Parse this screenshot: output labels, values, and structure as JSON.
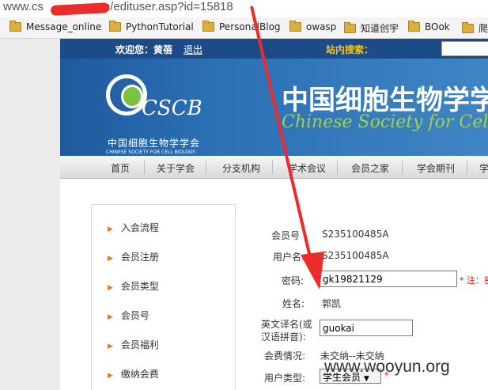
{
  "browser": {
    "url_visible": "www.cs",
    "url_path": "n/edituser.asp?id=15818",
    "bookmarks": [
      {
        "label": "Message_online",
        "icon": "folder-icon"
      },
      {
        "label": "PythonTutorial",
        "icon": "folder-icon"
      },
      {
        "label": "PersonalBlog",
        "icon": "folder-icon"
      },
      {
        "label": "owasp",
        "icon": "folder-icon"
      },
      {
        "label": "知道创宇",
        "icon": "folder-icon"
      },
      {
        "label": "BOok",
        "icon": "folder-icon"
      },
      {
        "label": "爬",
        "icon": "folder-icon"
      }
    ]
  },
  "topbar": {
    "welcome": "欢迎您：黄蓓",
    "logout": "退出",
    "site_search": "站内搜索："
  },
  "banner": {
    "logo_text": "CSCB",
    "logo_cn": "中国细胞生物学学会",
    "logo_en": "CHINESE SOCIETY FOR CELL BIOLOGY",
    "title_cn": "中国细胞生物学学",
    "title_en": "Chinese Society for Cell B"
  },
  "nav": {
    "items": [
      "首页",
      "关于学会",
      "分支机构",
      "学术会议",
      "会员之家",
      "学会期刊",
      "学"
    ]
  },
  "sidebar": {
    "items": [
      "入会流程",
      "会员注册",
      "会员类型",
      "会员号",
      "会员福利",
      "缴纳会费"
    ]
  },
  "form": {
    "member_no_label": "会员号",
    "member_no": "S235100485A",
    "username_label": "用户名:",
    "username": "S235100485A",
    "password_label": "密码:",
    "password_value": "gk19821129",
    "password_note": "* 注：密",
    "name_label": "姓名:",
    "name": "郭凯",
    "en_name_label_1": "英文译名(或",
    "en_name_label_2": "汉语拼音):",
    "en_name_value": "guokai",
    "fee_label": "会费情况:",
    "fee_value": "未交纳--未交纳",
    "user_type_label": "用户类型:",
    "user_type_value": "学生会员",
    "user_type_required": "*"
  },
  "watermark": "www.wooyun.org",
  "colors": {
    "topbar": "#1d4b87",
    "banner": "#2b6fb5",
    "title_en": "#9fd247",
    "annotation_arrow": "#ee2b2b",
    "logo_green": "#7ec142"
  }
}
